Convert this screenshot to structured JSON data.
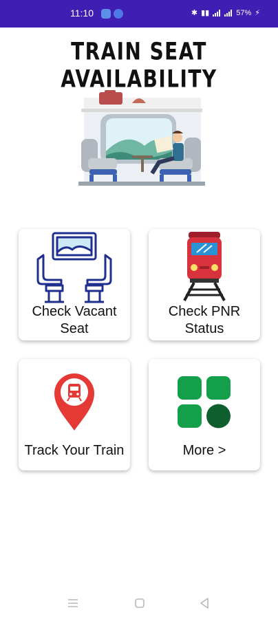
{
  "status_bar": {
    "time": "11:10",
    "battery": "57%"
  },
  "header": {
    "title": "TRAIN SEAT AVAILABILITY"
  },
  "cards": [
    {
      "label_lines": [
        "Check Vacant",
        "Seat"
      ],
      "icon": "train-seats-icon"
    },
    {
      "label_lines": [
        "Check PNR",
        "Status"
      ],
      "icon": "train-front-icon"
    },
    {
      "label_lines": [
        "Track Your Train"
      ],
      "icon": "train-location-pin-icon"
    },
    {
      "label_lines": [
        "More >"
      ],
      "icon": "grid-apps-icon"
    }
  ],
  "nav_bar": {
    "icons": [
      "menu-icon",
      "home-square-icon",
      "back-triangle-icon"
    ]
  },
  "colors": {
    "status_bar": "#3f1fb3",
    "icon_navy": "#1f2f8f",
    "train_red": "#d8323c",
    "pin_red": "#e53935",
    "grid_green": "#14a04a",
    "grid_dark_green": "#0f5f2e"
  }
}
